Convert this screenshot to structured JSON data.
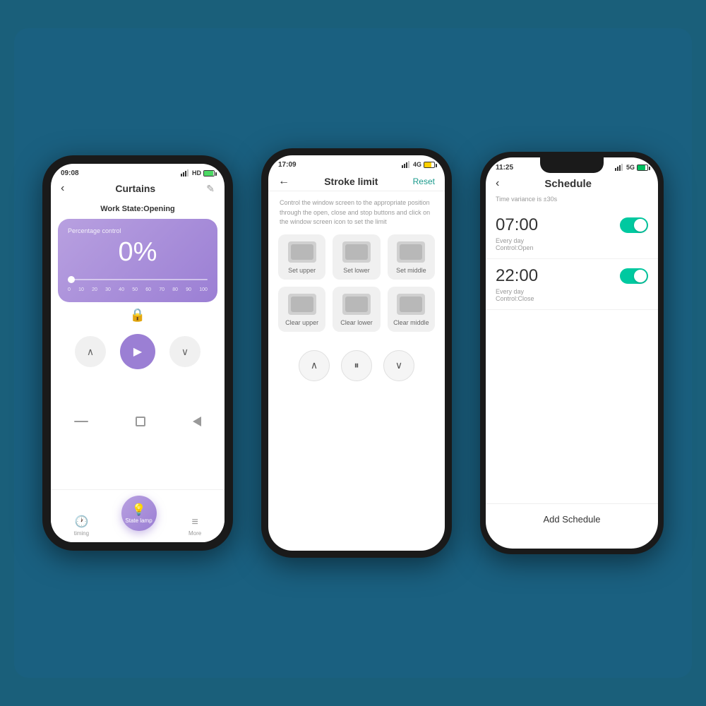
{
  "background": "#1a6080",
  "phone1": {
    "status": {
      "time": "09:08",
      "signal": "HD",
      "icons": [
        "wifi",
        "battery"
      ]
    },
    "header": {
      "back": "‹",
      "title": "Curtains",
      "edit": "✎"
    },
    "workState": "Work State:Opening",
    "card": {
      "label": "Percentage control",
      "value": "0%",
      "sliderLabels": [
        "0",
        "10",
        "20",
        "30",
        "40",
        "50",
        "60",
        "70",
        "80",
        "90",
        "100"
      ]
    },
    "controls": {
      "up": "∧",
      "play": "▶",
      "down": "∨"
    },
    "bottomNav": [
      {
        "icon": "🕐",
        "label": "timing"
      },
      {
        "icon": "💡",
        "label": "State lamp",
        "fab": true
      },
      {
        "icon": "≡",
        "label": "More"
      }
    ]
  },
  "phone2": {
    "status": {
      "time": "17:09",
      "signal": "4G"
    },
    "header": {
      "back": "←",
      "title": "Stroke limit",
      "reset": "Reset"
    },
    "description": "Control the window screen to the appropriate position through the open, close and stop buttons and click on the window screen icon to set the limit",
    "buttons": [
      {
        "label": "Set upper"
      },
      {
        "label": "Set lower"
      },
      {
        "label": "Set middle"
      },
      {
        "label": "Clear upper"
      },
      {
        "label": "Clear lower"
      },
      {
        "label": "Clear middle"
      }
    ],
    "controls": {
      "up": "∧",
      "pause": "⏸",
      "down": "∨"
    }
  },
  "phone3": {
    "status": {
      "time": "11:25",
      "signal": "5G"
    },
    "header": {
      "back": "‹",
      "title": "Schedule"
    },
    "note": "Time variance is ±30s",
    "schedules": [
      {
        "time": "07:00",
        "repeat": "Every day",
        "control": "Control:Open",
        "enabled": true
      },
      {
        "time": "22:00",
        "repeat": "Every day",
        "control": "Control:Close",
        "enabled": true
      }
    ],
    "addButton": "Add Schedule"
  }
}
